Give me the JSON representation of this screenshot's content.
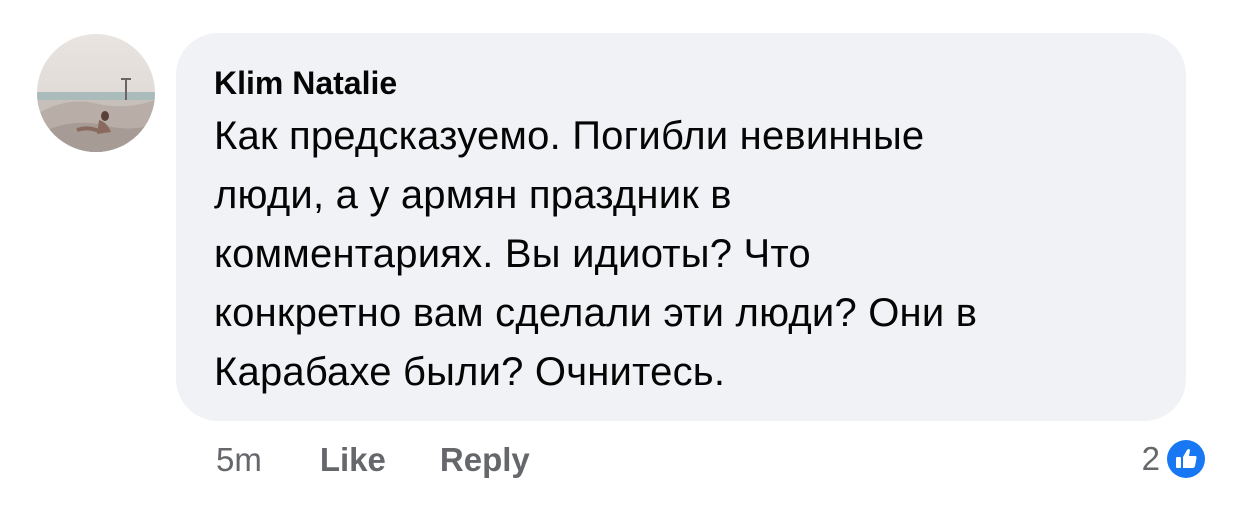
{
  "comment": {
    "author": "Klim Natalie",
    "text": "Как предсказуемо. Погибли невинные\nлюди,  а у армян праздник в\nкомментариях. Вы идиоты? Что\nконкретно вам  сделали эти люди? Они в\nКарабахе были?  Очнитесь."
  },
  "actions": {
    "time": "5m",
    "like_label": "Like",
    "reply_label": "Reply"
  },
  "reactions": {
    "count": "2",
    "icon": "like-icon",
    "color": "#1877f2"
  },
  "colors": {
    "bubble": "#f0f2f5",
    "text": "#050505",
    "secondary": "#65676b"
  }
}
